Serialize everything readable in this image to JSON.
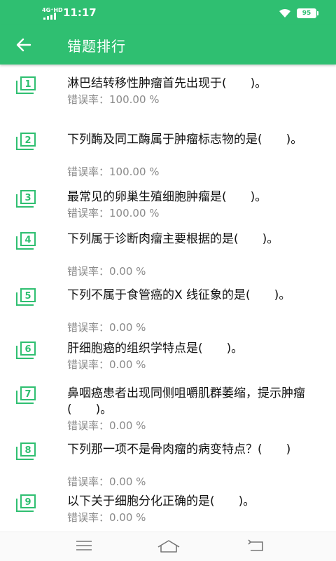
{
  "status": {
    "time": "11:17",
    "signal": "4G⁺HD",
    "battery": "95"
  },
  "app_bar": {
    "title": "错题排行"
  },
  "colors": {
    "accent": "#2fbf71",
    "icon": "#2fbf71"
  },
  "items": [
    {
      "num": "1",
      "question": "淋巴结转移性肿瘤首先出现于(　　)。",
      "rate": "错误率：100.00 %"
    },
    {
      "num": "2",
      "question": "下列酶及同工酶属于肿瘤标志物的是(　　)。",
      "rate": "错误率：100.00 %"
    },
    {
      "num": "3",
      "question": "最常见的卵巢生殖细胞肿瘤是(　　)。",
      "rate": "错误率：100.00 %"
    },
    {
      "num": "4",
      "question": "下列属于诊断肉瘤主要根据的是(　　)。",
      "rate": "错误率：0.00 %"
    },
    {
      "num": "5",
      "question": "下列不属于食管癌的X 线征象的是(　　)。",
      "rate": "错误率：0.00 %"
    },
    {
      "num": "6",
      "question": "肝细胞癌的组织学特点是(　　)。",
      "rate": "错误率：0.00 %"
    },
    {
      "num": "7",
      "question": "鼻咽癌患者出现同侧咀嚼肌群萎缩，提示肿瘤(　　)。",
      "rate": "错误率：0.00 %"
    },
    {
      "num": "8",
      "question": "下列那一项不是骨肉瘤的病变特点？(　　)",
      "rate": "错误率：0.00 %"
    },
    {
      "num": "9",
      "question": "以下关于细胞分化正确的是(　　)。",
      "rate": "错误率：0.00 %"
    }
  ],
  "nav": {
    "menu_icon": "menu-icon",
    "home_icon": "home-icon",
    "back_icon": "back-nav-icon"
  }
}
